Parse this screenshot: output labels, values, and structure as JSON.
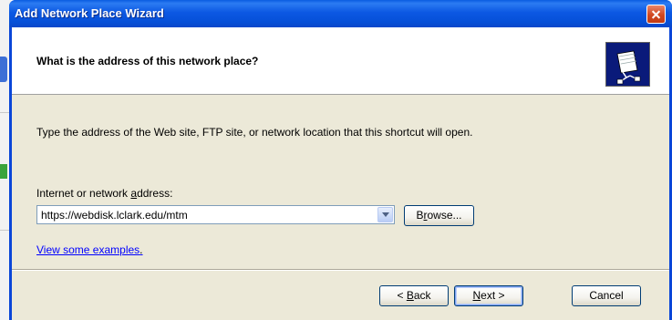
{
  "window": {
    "title": "Add Network Place Wizard"
  },
  "header": {
    "question": "What is the address of this network place?"
  },
  "body": {
    "instruction": "Type the address of the Web site, FTP site, or network location that this shortcut will open.",
    "address_label_pre": "Internet or network ",
    "address_label_accel": "a",
    "address_label_post": "ddress:",
    "address_value": "https://webdisk.lclark.edu/mtm",
    "browse_accel": "r",
    "browse_pre": "B",
    "browse_post": "owse...",
    "examples_link": "View some examples",
    "examples_suffix": "."
  },
  "footer": {
    "back_prefix": "< ",
    "back_accel": "B",
    "back_post": "ack",
    "next_accel": "N",
    "next_post": "ext >",
    "cancel_label": "Cancel"
  }
}
